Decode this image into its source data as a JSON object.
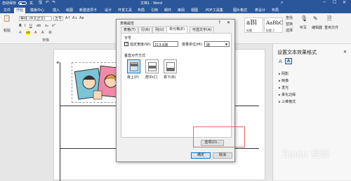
{
  "titlebar": {
    "autosave_label": "自动保存",
    "autosave_state": "关",
    "doc_title": "文档1 - Word",
    "colors": {
      "accent": "#2b579a"
    }
  },
  "ribbon_tabs": [
    "文件",
    "开始",
    "模板中心",
    "插入",
    "绘图",
    "新建选项卡",
    "设计",
    "开发工具",
    "布局",
    "引用",
    "邮件",
    "审阅",
    "视图",
    "PDF工具集",
    "图片格式",
    "表设计",
    "布局"
  ],
  "ribbon": {
    "font_name": "等线 (中文正文)",
    "font_size": "五号",
    "group_font": "字体",
    "paste_label": "粘贴",
    "style1_sample": "aBl",
    "style1_name": "标题",
    "style2_sample": "AaBbC",
    "style2_name": "标题 2",
    "search_label": "查找",
    "replace_label": "替换",
    "select_label": "选择",
    "dictate_label": "听写",
    "editor_label": "编辑器",
    "reuse_label": "重用文件"
  },
  "dialog": {
    "title": "表格属性",
    "help": "?",
    "tabs": [
      "表格(T)",
      "行(R)",
      "列(U)",
      "单元格(E)",
      "可选文字(A)"
    ],
    "active_tab": 3,
    "section_size": "字号",
    "pref_width_label": "指定宽度(W):",
    "pref_width_value": "213.6磅",
    "measure_label": "度量单位(M):",
    "measure_value": "磅",
    "valign_section": "垂直对齐方式",
    "valign_options": [
      "靠上(P)",
      "居中(C)",
      "靠下(B)"
    ],
    "options_button": "选项(O)...",
    "ok_button": "确定",
    "cancel_button": "取消"
  },
  "right_pane": {
    "title": "设置文本效果格式",
    "tab_a": "A",
    "items": [
      "阴影",
      "映像",
      "发光",
      "柔化边缘",
      "三维格式"
    ]
  },
  "watermark": "Baidu 经验",
  "highlight_color": "#e8646e"
}
